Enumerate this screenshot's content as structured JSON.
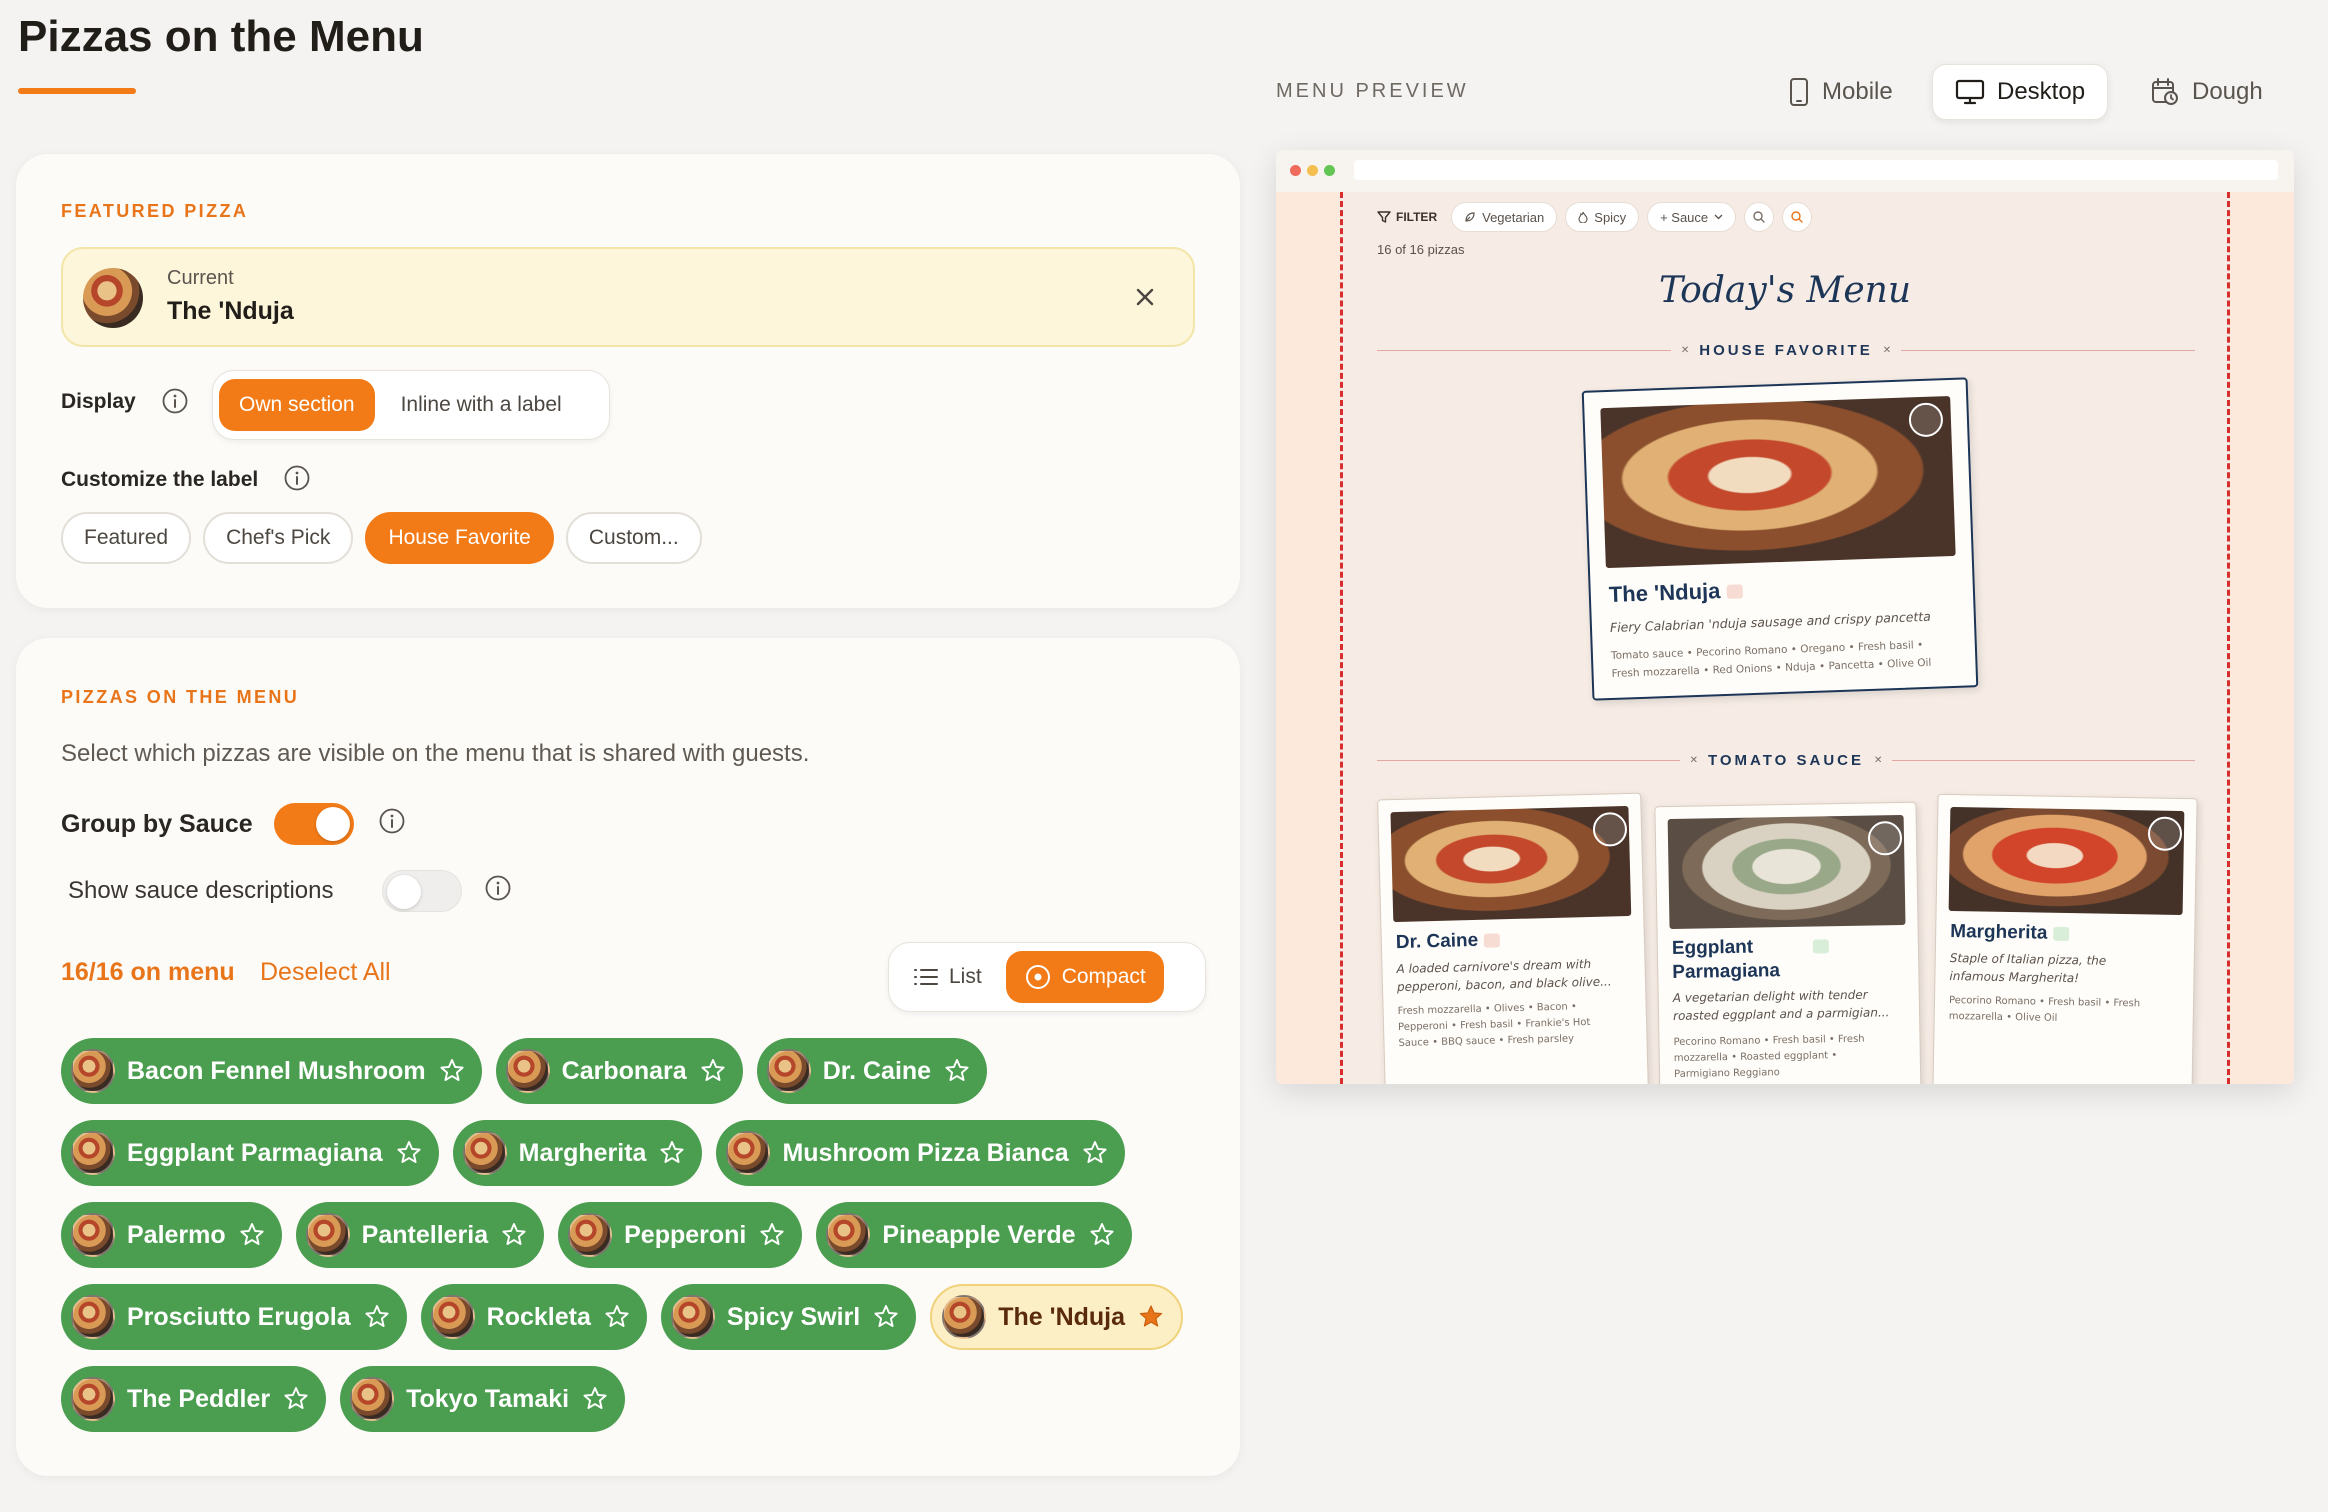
{
  "page": {
    "title": "Pizzas on the Menu"
  },
  "featured": {
    "section_label": "FEATURED PIZZA",
    "current_label": "Current",
    "current_name": "The 'Nduja",
    "display_label": "Display",
    "display_options": [
      "Own section",
      "Inline with a label"
    ],
    "display_selected": "Own section",
    "customize_label": "Customize the label",
    "label_options": [
      "Featured",
      "Chef's Pick",
      "House Favorite",
      "Custom..."
    ],
    "label_selected": "House Favorite"
  },
  "menu": {
    "section_label": "PIZZAS ON THE MENU",
    "description": "Select which pizzas are visible on the menu that is shared with guests.",
    "group_by_sauce_label": "Group by Sauce",
    "group_by_sauce_on": true,
    "show_desc_label": "Show sauce descriptions",
    "show_desc_on": false,
    "count_text": "16/16 on menu",
    "deselect_label": "Deselect All",
    "view_options": [
      "List",
      "Compact"
    ],
    "view_selected": "Compact",
    "pizzas": [
      {
        "name": "Bacon Fennel Mushroom",
        "featured": false
      },
      {
        "name": "Carbonara",
        "featured": false
      },
      {
        "name": "Dr. Caine",
        "featured": false
      },
      {
        "name": "Eggplant Parmagiana",
        "featured": false
      },
      {
        "name": "Margherita",
        "featured": false
      },
      {
        "name": "Mushroom Pizza Bianca",
        "featured": false
      },
      {
        "name": "Palermo",
        "featured": false
      },
      {
        "name": "Pantelleria",
        "featured": false
      },
      {
        "name": "Pepperoni",
        "featured": false
      },
      {
        "name": "Pineapple Verde",
        "featured": false
      },
      {
        "name": "Prosciutto Erugola",
        "featured": false
      },
      {
        "name": "Rockleta",
        "featured": false
      },
      {
        "name": "Spicy Swirl",
        "featured": false
      },
      {
        "name": "The 'Nduja",
        "featured": true
      },
      {
        "name": "The Peddler",
        "featured": false
      },
      {
        "name": "Tokyo Tamaki",
        "featured": false
      }
    ]
  },
  "preview": {
    "label": "MENU PREVIEW",
    "devices": [
      "Mobile",
      "Desktop",
      "Dough"
    ],
    "device_selected": "Desktop",
    "filter_label": "FILTER",
    "filter_chips": [
      "Vegetarian",
      "Spicy",
      "+ Sauce"
    ],
    "count": "16 of 16 pizzas",
    "menu_title": "Today's Menu",
    "house_section": "HOUSE FAVORITE",
    "tomato_section": "TOMATO SAUCE",
    "house_card": {
      "name": "The 'Nduja",
      "desc": "Fiery Calabrian 'nduja sausage and crispy pancetta",
      "ingredients_1": "Tomato sauce • Pecorino Romano • Oregano • Fresh basil •",
      "ingredients_2": "Fresh mozzarella • Red Onions • Nduja • Pancetta • Olive Oil"
    },
    "cards": [
      {
        "name": "Dr. Caine",
        "desc_1": "A loaded carnivore's dream with",
        "desc_2": "pepperoni, bacon, and black olive...",
        "ing_1": "Fresh mozzarella • Olives • Bacon •",
        "ing_2": "Pepperoni • Fresh basil • Frankie's Hot",
        "ing_3": "Sauce • BBQ sauce • Fresh parsley"
      },
      {
        "name_1": "Eggplant",
        "name_2": "Parmagiana",
        "desc_1": "A vegetarian delight with tender",
        "desc_2": "roasted eggplant and a parmigian...",
        "ing_1": "Pecorino Romano • Fresh basil • Fresh",
        "ing_2": "mozzarella • Roasted eggplant •",
        "ing_3": "Parmigiano Reggiano"
      },
      {
        "name": "Margherita",
        "desc_1": "Staple of Italian pizza, the",
        "desc_2": "infamous Margherita!",
        "ing_1": "Pecorino Romano • Fresh basil • Fresh",
        "ing_2": "mozzarella • Olive Oil"
      }
    ]
  },
  "colors": {
    "accent": "#f27b17",
    "pill_green": "#4b9e50",
    "menu_navy": "#1d3557",
    "dashed_red": "#d82d2d"
  }
}
